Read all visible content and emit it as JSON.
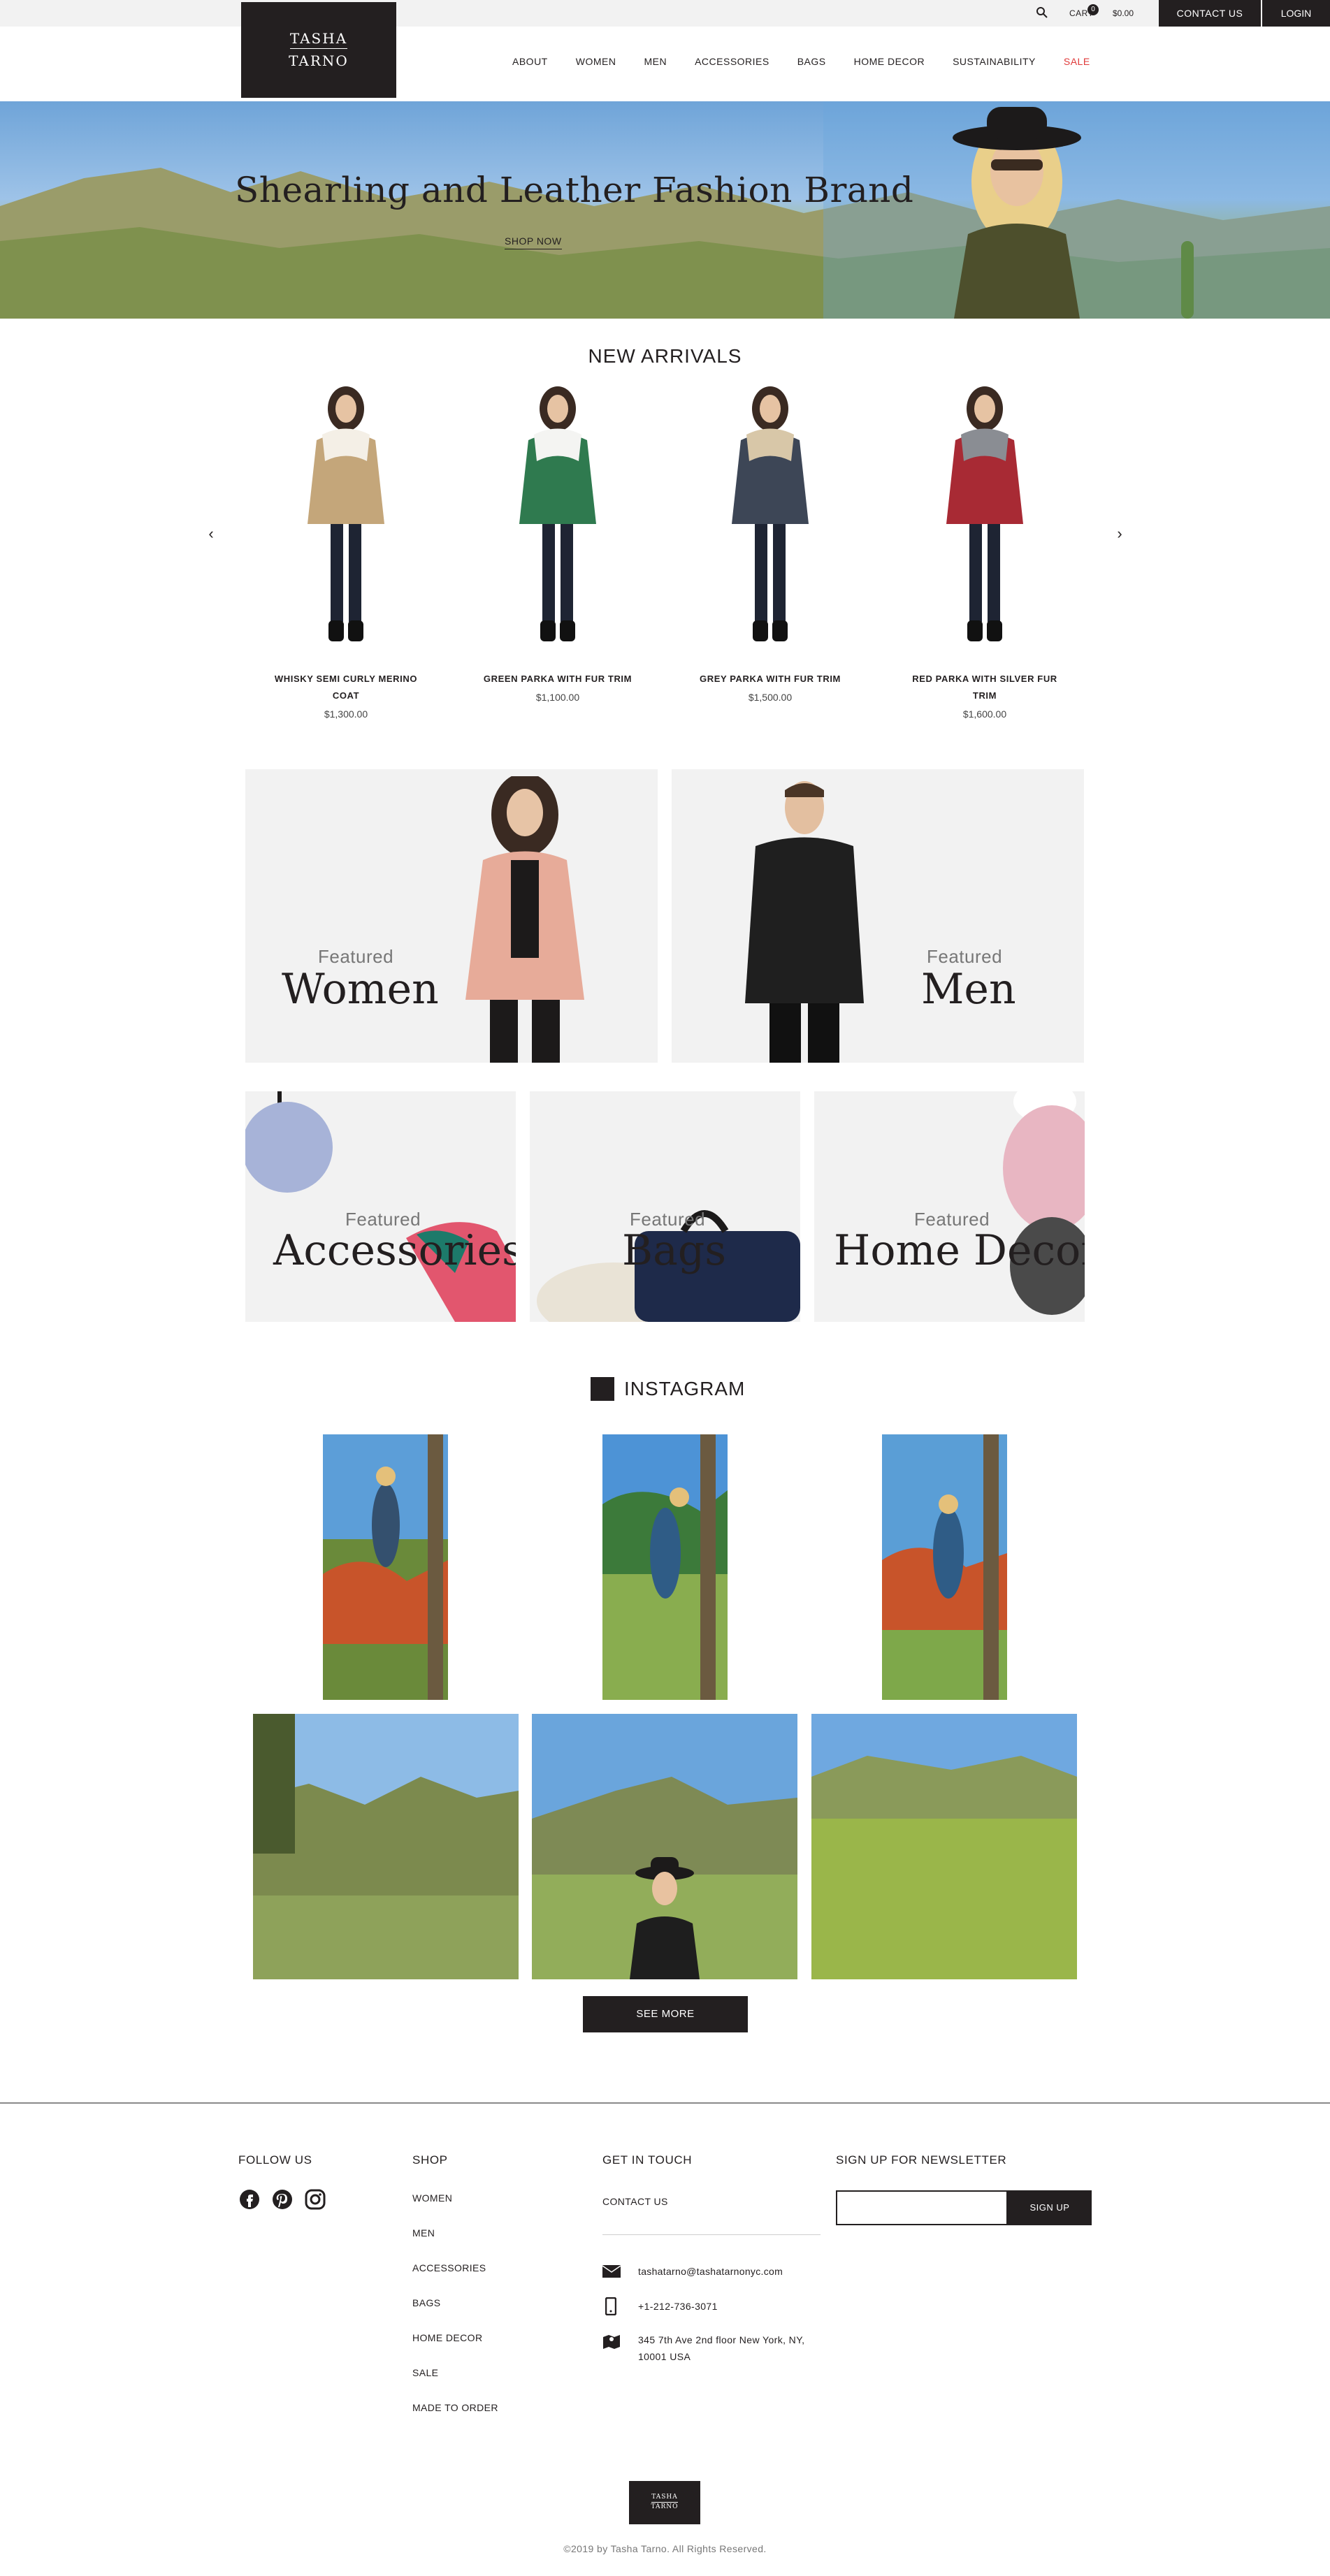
{
  "topbar": {
    "search_icon": "search-icon",
    "cart_label": "CART",
    "cart_count": "0",
    "cart_total": "$0.00",
    "contact_label": "CONTACT US",
    "login_label": "LOGIN"
  },
  "logo": {
    "line1": "TASHA",
    "line2": "TARNO"
  },
  "nav": {
    "items": [
      "ABOUT",
      "WOMEN",
      "MEN",
      "ACCESSORIES",
      "BAGS",
      "HOME DECOR",
      "SUSTAINABILITY",
      "SALE"
    ],
    "sale_color": "#e03a3a"
  },
  "hero": {
    "title": "Shearling and Leather Fashion Brand",
    "cta": "SHOP NOW"
  },
  "new_arrivals": {
    "title": "NEW ARRIVALS",
    "products": [
      {
        "name": "WHISKY SEMI CURLY MERINO COAT",
        "price": "$1,300.00",
        "coat_color": "#c4a67a",
        "trim_color": "#f4efe6"
      },
      {
        "name": "GREEN PARKA WITH FUR TRIM",
        "price": "$1,100.00",
        "coat_color": "#2f7a4f",
        "trim_color": "#f4f4f2"
      },
      {
        "name": "GREY PARKA WITH FUR TRIM",
        "price": "$1,500.00",
        "coat_color": "#3d4656",
        "trim_color": "#d8c7a8"
      },
      {
        "name": "RED PARKA WITH SILVER FUR TRIM",
        "price": "$1,600.00",
        "coat_color": "#a82a34",
        "trim_color": "#8a8d93"
      }
    ],
    "prev_icon": "chevron-left-icon",
    "next_icon": "chevron-right-icon"
  },
  "featured": {
    "women": {
      "small": "Featured",
      "big": "Women"
    },
    "men": {
      "small": "Featured",
      "big": "Men"
    },
    "accessories": {
      "small": "Featured",
      "big": "Accessories"
    },
    "bags": {
      "small": "Featured",
      "big": "Bags"
    },
    "home_decor": {
      "small": "Featured",
      "big": "Home Decor"
    }
  },
  "instagram": {
    "title": "INSTAGRAM",
    "see_more": "SEE MORE"
  },
  "footer": {
    "follow_title": "FOLLOW US",
    "social_icons": [
      "facebook-icon",
      "pinterest-icon",
      "instagram-icon"
    ],
    "shop_title": "SHOP",
    "shop_links": [
      "WOMEN",
      "MEN",
      "ACCESSORIES",
      "BAGS",
      "HOME DECOR",
      "SALE",
      "MADE TO ORDER"
    ],
    "touch_title": "GET IN TOUCH",
    "contact_link": "CONTACT US",
    "email": "tashatarno@tashatarnonyc.com",
    "phone": "+1-212-736-3071",
    "address": "345 7th Ave 2nd floor New York, NY, 10001 USA",
    "newsletter_title": "SIGN UP FOR NEWSLETTER",
    "newsletter_placeholder": "",
    "signup_label": "SIGN UP",
    "logo_line1": "TASHA",
    "logo_line2": "TARNO",
    "copyright": "©2019 by Tasha Tarno. All Rights Reserved."
  }
}
